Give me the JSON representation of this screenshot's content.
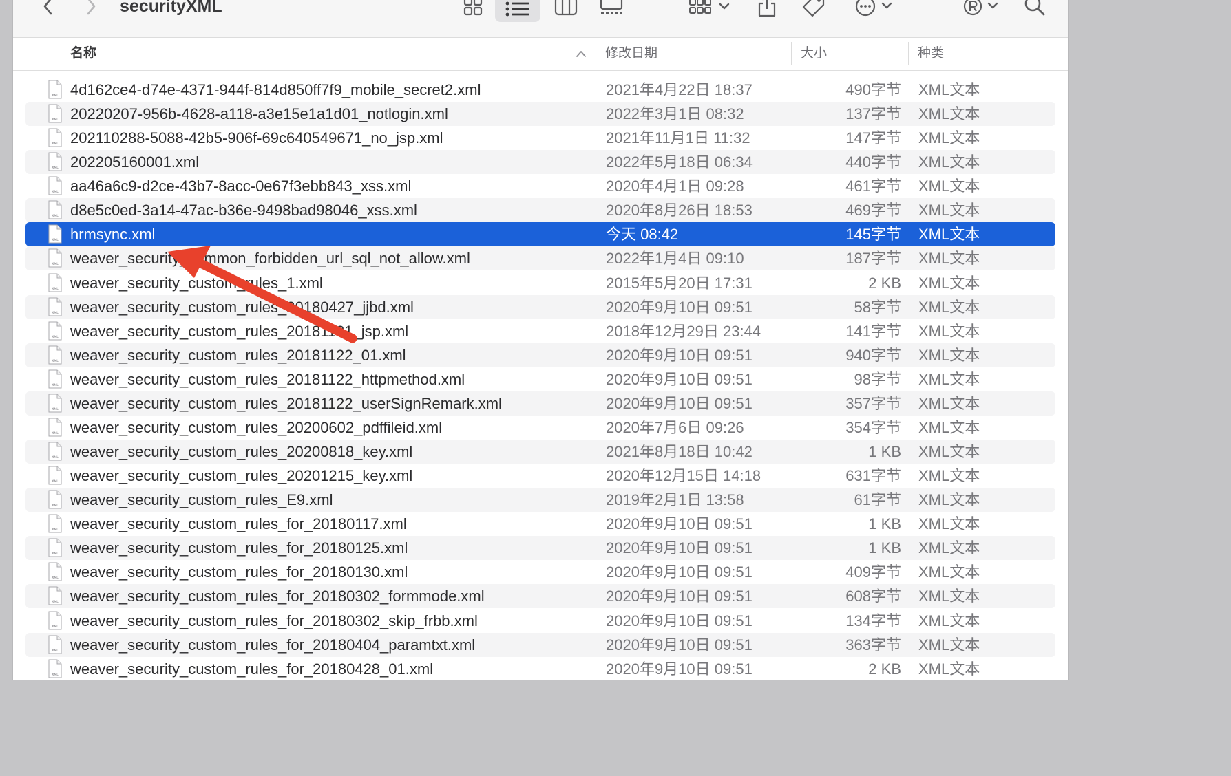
{
  "window": {
    "title": "securityXML"
  },
  "toolbar": {
    "icons": [
      "chevron-left-icon",
      "chevron-right-icon",
      "icon-view-icon",
      "list-view-icon",
      "column-view-icon",
      "gallery-view-icon",
      "group-icon",
      "share-icon",
      "tag-icon",
      "more-icon",
      "profile-icon",
      "search-icon"
    ]
  },
  "columns": {
    "name": "名称",
    "date": "修改日期",
    "size": "大小",
    "kind": "种类"
  },
  "colors": {
    "selection": "#1b61d9",
    "annotation_arrow": "#e8412c"
  },
  "files": [
    {
      "name": "4d162ce4-d74e-4371-944f-814d850ff7f9_mobile_secret2.xml",
      "date": "2021年4月22日 18:37",
      "size": "490字节",
      "kind": "XML文本"
    },
    {
      "name": "20220207-956b-4628-a118-a3e15e1a1d01_notlogin.xml",
      "date": "2022年3月1日 08:32",
      "size": "137字节",
      "kind": "XML文本"
    },
    {
      "name": "202110288-5088-42b5-906f-69c640549671_no_jsp.xml",
      "date": "2021年11月1日 11:32",
      "size": "147字节",
      "kind": "XML文本"
    },
    {
      "name": "202205160001.xml",
      "date": "2022年5月18日 06:34",
      "size": "440字节",
      "kind": "XML文本"
    },
    {
      "name": "aa46a6c9-d2ce-43b7-8acc-0e67f3ebb843_xss.xml",
      "date": "2020年4月1日 09:28",
      "size": "461字节",
      "kind": "XML文本"
    },
    {
      "name": "d8e5c0ed-3a14-47ac-b36e-9498bad98046_xss.xml",
      "date": "2020年8月26日 18:53",
      "size": "469字节",
      "kind": "XML文本"
    },
    {
      "name": "hrmsync.xml",
      "date": "今天 08:42",
      "size": "145字节",
      "kind": "XML文本",
      "selected": true
    },
    {
      "name": "weaver_security_common_forbidden_url_sql_not_allow.xml",
      "date": "2022年1月4日 09:10",
      "size": "187字节",
      "kind": "XML文本"
    },
    {
      "name": "weaver_security_custom_rules_1.xml",
      "date": "2015年5月20日 17:31",
      "size": "2 KB",
      "kind": "XML文本"
    },
    {
      "name": "weaver_security_custom_rules_20180427_jjbd.xml",
      "date": "2020年9月10日 09:51",
      "size": "58字节",
      "kind": "XML文本"
    },
    {
      "name": "weaver_security_custom_rules_20181121_jsp.xml",
      "date": "2018年12月29日 23:44",
      "size": "141字节",
      "kind": "XML文本"
    },
    {
      "name": "weaver_security_custom_rules_20181122_01.xml",
      "date": "2020年9月10日 09:51",
      "size": "940字节",
      "kind": "XML文本"
    },
    {
      "name": "weaver_security_custom_rules_20181122_httpmethod.xml",
      "date": "2020年9月10日 09:51",
      "size": "98字节",
      "kind": "XML文本"
    },
    {
      "name": "weaver_security_custom_rules_20181122_userSignRemark.xml",
      "date": "2020年9月10日 09:51",
      "size": "357字节",
      "kind": "XML文本"
    },
    {
      "name": "weaver_security_custom_rules_20200602_pdffileid.xml",
      "date": "2020年7月6日 09:26",
      "size": "354字节",
      "kind": "XML文本"
    },
    {
      "name": "weaver_security_custom_rules_20200818_key.xml",
      "date": "2021年8月18日 10:42",
      "size": "1 KB",
      "kind": "XML文本"
    },
    {
      "name": "weaver_security_custom_rules_20201215_key.xml",
      "date": "2020年12月15日 14:18",
      "size": "631字节",
      "kind": "XML文本"
    },
    {
      "name": "weaver_security_custom_rules_E9.xml",
      "date": "2019年2月1日 13:58",
      "size": "61字节",
      "kind": "XML文本"
    },
    {
      "name": "weaver_security_custom_rules_for_20180117.xml",
      "date": "2020年9月10日 09:51",
      "size": "1 KB",
      "kind": "XML文本"
    },
    {
      "name": "weaver_security_custom_rules_for_20180125.xml",
      "date": "2020年9月10日 09:51",
      "size": "1 KB",
      "kind": "XML文本"
    },
    {
      "name": "weaver_security_custom_rules_for_20180130.xml",
      "date": "2020年9月10日 09:51",
      "size": "409字节",
      "kind": "XML文本"
    },
    {
      "name": "weaver_security_custom_rules_for_20180302_formmode.xml",
      "date": "2020年9月10日 09:51",
      "size": "608字节",
      "kind": "XML文本"
    },
    {
      "name": "weaver_security_custom_rules_for_20180302_skip_frbb.xml",
      "date": "2020年9月10日 09:51",
      "size": "134字节",
      "kind": "XML文本"
    },
    {
      "name": "weaver_security_custom_rules_for_20180404_paramtxt.xml",
      "date": "2020年9月10日 09:51",
      "size": "363字节",
      "kind": "XML文本"
    },
    {
      "name": "weaver_security_custom_rules_for_20180428_01.xml",
      "date": "2020年9月10日 09:51",
      "size": "2 KB",
      "kind": "XML文本"
    }
  ]
}
